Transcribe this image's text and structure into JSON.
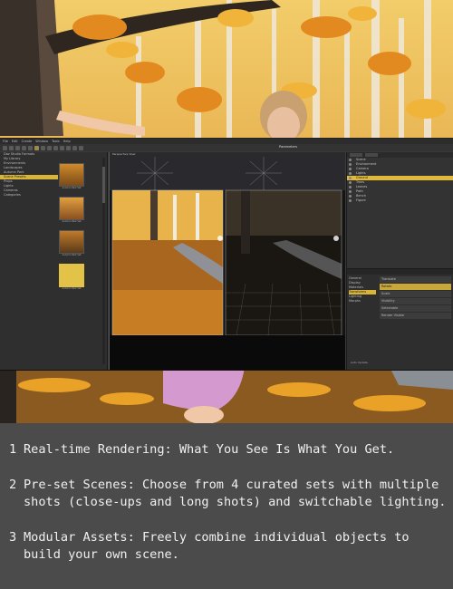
{
  "app": {
    "menu": [
      "File",
      "Edit",
      "Create",
      "Window",
      "Tools",
      "Help"
    ],
    "window_title": "Parameters",
    "viewport_title": "Perspective View",
    "library_tree": [
      "Daz Studio Formats",
      "My Library",
      "Environments",
      "Landscapes",
      "Autumn Park",
      "Scene Presets",
      "Props",
      "Lights",
      "Cameras",
      "Categories"
    ],
    "library_selected": "Scene Presets",
    "thumbs": [
      "Autumn Park Set",
      "Autumn Park Set",
      "Autumn Park Set",
      "Autumn Park Set"
    ],
    "scene_tree": [
      "Scene",
      "Environment",
      "Camera",
      "Lights",
      "Ground",
      "Trees",
      "Leaves",
      "Path",
      "Bench",
      "Figure"
    ],
    "scene_selected": "Ground",
    "param_categories": [
      "General",
      "Display",
      "Materials",
      "Transforms",
      "Lighting",
      "Morphs"
    ],
    "param_selected": "Transforms",
    "param_fields": [
      "Translate",
      "Rotate",
      "Scale",
      "Visibility",
      "Selectable",
      "Render Visible"
    ],
    "bottom_note": "Auto Update"
  },
  "captions": [
    {
      "num": "1",
      "text": "Real-time Rendering: What You See Is What You Get."
    },
    {
      "num": "2",
      "text": "Pre-set Scenes: Choose from 4 curated sets with multiple shots (close-ups and long shots) and switchable lighting."
    },
    {
      "num": "3",
      "text": "Modular Assets: Freely combine individual objects to build your own scene."
    }
  ],
  "colors": {
    "accent": "#e0b93b",
    "panel": "#333333",
    "background": "#4b4b4b"
  }
}
